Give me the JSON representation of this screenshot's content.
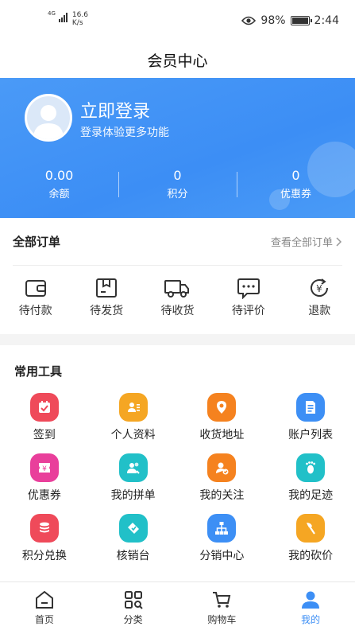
{
  "status_bar": {
    "signal_label": "4G",
    "net_speed_value": "16.6",
    "net_speed_unit": "K/s",
    "battery": "98%",
    "time": "2:44"
  },
  "title": "会员中心",
  "header": {
    "login_title": "立即登录",
    "login_subtitle": "登录体验更多功能",
    "stats": [
      {
        "value": "0.00",
        "label": "余额"
      },
      {
        "value": "0",
        "label": "积分"
      },
      {
        "value": "0",
        "label": "优惠券"
      }
    ]
  },
  "orders": {
    "title": "全部订单",
    "view_all": "查看全部订单",
    "items": [
      {
        "label": "待付款",
        "icon": "wallet-icon"
      },
      {
        "label": "待发货",
        "icon": "package-icon"
      },
      {
        "label": "待收货",
        "icon": "truck-icon"
      },
      {
        "label": "待评价",
        "icon": "comment-icon"
      },
      {
        "label": "退款",
        "icon": "refund-icon"
      }
    ]
  },
  "tools": {
    "title": "常用工具",
    "items": [
      {
        "label": "签到",
        "icon": "checkin-icon",
        "color": "#ef4a5a"
      },
      {
        "label": "个人资料",
        "icon": "profile-card-icon",
        "color": "#f5a623"
      },
      {
        "label": "收货地址",
        "icon": "location-pin-icon",
        "color": "#f5821f"
      },
      {
        "label": "账户列表",
        "icon": "document-list-icon",
        "color": "#3d8ff5"
      },
      {
        "label": "优惠券",
        "icon": "coupon-icon",
        "color": "#e93f9b"
      },
      {
        "label": "我的拼单",
        "icon": "group-buy-icon",
        "color": "#21c0c8"
      },
      {
        "label": "我的关注",
        "icon": "follow-user-icon",
        "color": "#f5821f"
      },
      {
        "label": "我的足迹",
        "icon": "footprint-icon",
        "color": "#21c0c8"
      },
      {
        "label": "积分兑换",
        "icon": "points-stack-icon",
        "color": "#ef4a5a"
      },
      {
        "label": "核销台",
        "icon": "ticket-check-icon",
        "color": "#21c0c8"
      },
      {
        "label": "分销中心",
        "icon": "network-icon",
        "color": "#3d8ff5"
      },
      {
        "label": "我的砍价",
        "icon": "axe-icon",
        "color": "#f5a623"
      }
    ]
  },
  "tabbar": {
    "items": [
      {
        "label": "首页",
        "icon": "home-icon",
        "active": false
      },
      {
        "label": "分类",
        "icon": "category-icon",
        "active": false
      },
      {
        "label": "购物车",
        "icon": "cart-icon",
        "active": false
      },
      {
        "label": "我的",
        "icon": "user-icon",
        "active": true
      }
    ],
    "active_color": "#3d8ff5"
  }
}
